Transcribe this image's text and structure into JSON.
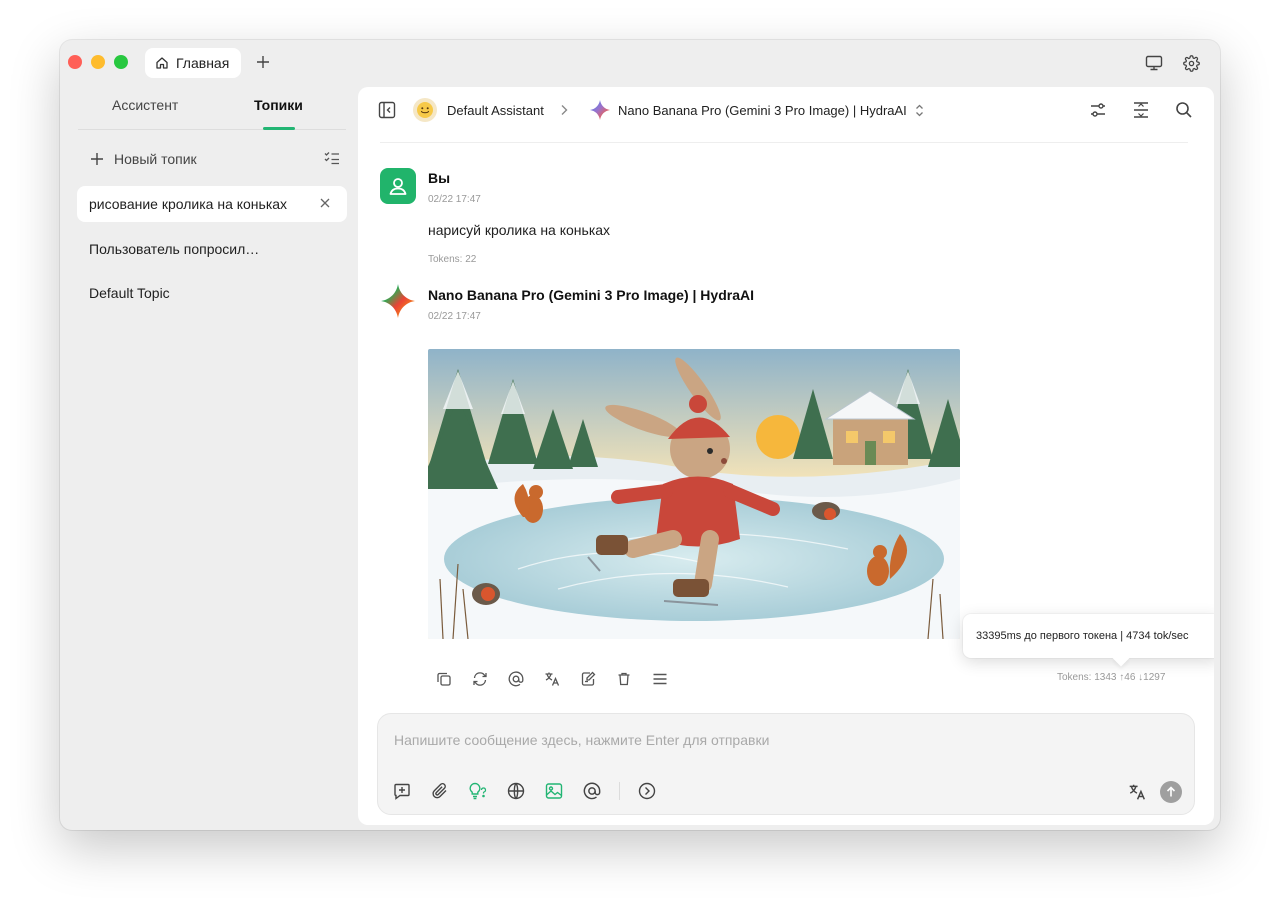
{
  "window": {
    "tab": {
      "label": "Главная",
      "icon": "home-icon"
    },
    "add_tab_icon": "plus-icon",
    "right_icons": [
      "monitor-icon",
      "gear-icon"
    ]
  },
  "sidebar": {
    "tabs": [
      {
        "label": "Ассистент",
        "active": false
      },
      {
        "label": "Топики",
        "active": true
      }
    ],
    "new_topic_label": "Новый топик",
    "topics": [
      {
        "label": "рисование кролика на коньках",
        "active": true
      },
      {
        "label": "Пользователь попросил…",
        "active": false
      },
      {
        "label": "Default Topic",
        "active": false
      }
    ]
  },
  "header": {
    "assistant_name": "Default Assistant",
    "model_name": "Nano Banana Pro (Gemini 3 Pro Image) | HydraAI"
  },
  "messages": [
    {
      "author": "Вы",
      "time": "02/22 17:47",
      "text": "нарисуй кролика на коньках",
      "tokens": "Tokens: 22"
    },
    {
      "author": "Nano Banana Pro (Gemini 3 Pro Image) | HydraAI",
      "time": "02/22 17:47",
      "image": "rabbit-ice-skating-illustration",
      "tokens": "Tokens: 1343 ↑46 ↓1297"
    }
  ],
  "tooltip": "33395ms до первого токена | 4734 tok/sec",
  "composer": {
    "placeholder": "Напишите сообщение здесь, нажмите Enter для отправки"
  },
  "colors": {
    "accent": "#22b573",
    "user_avatar": "#21b46b",
    "window_bg": "#eeeeee",
    "panel_bg": "#ffffff"
  }
}
